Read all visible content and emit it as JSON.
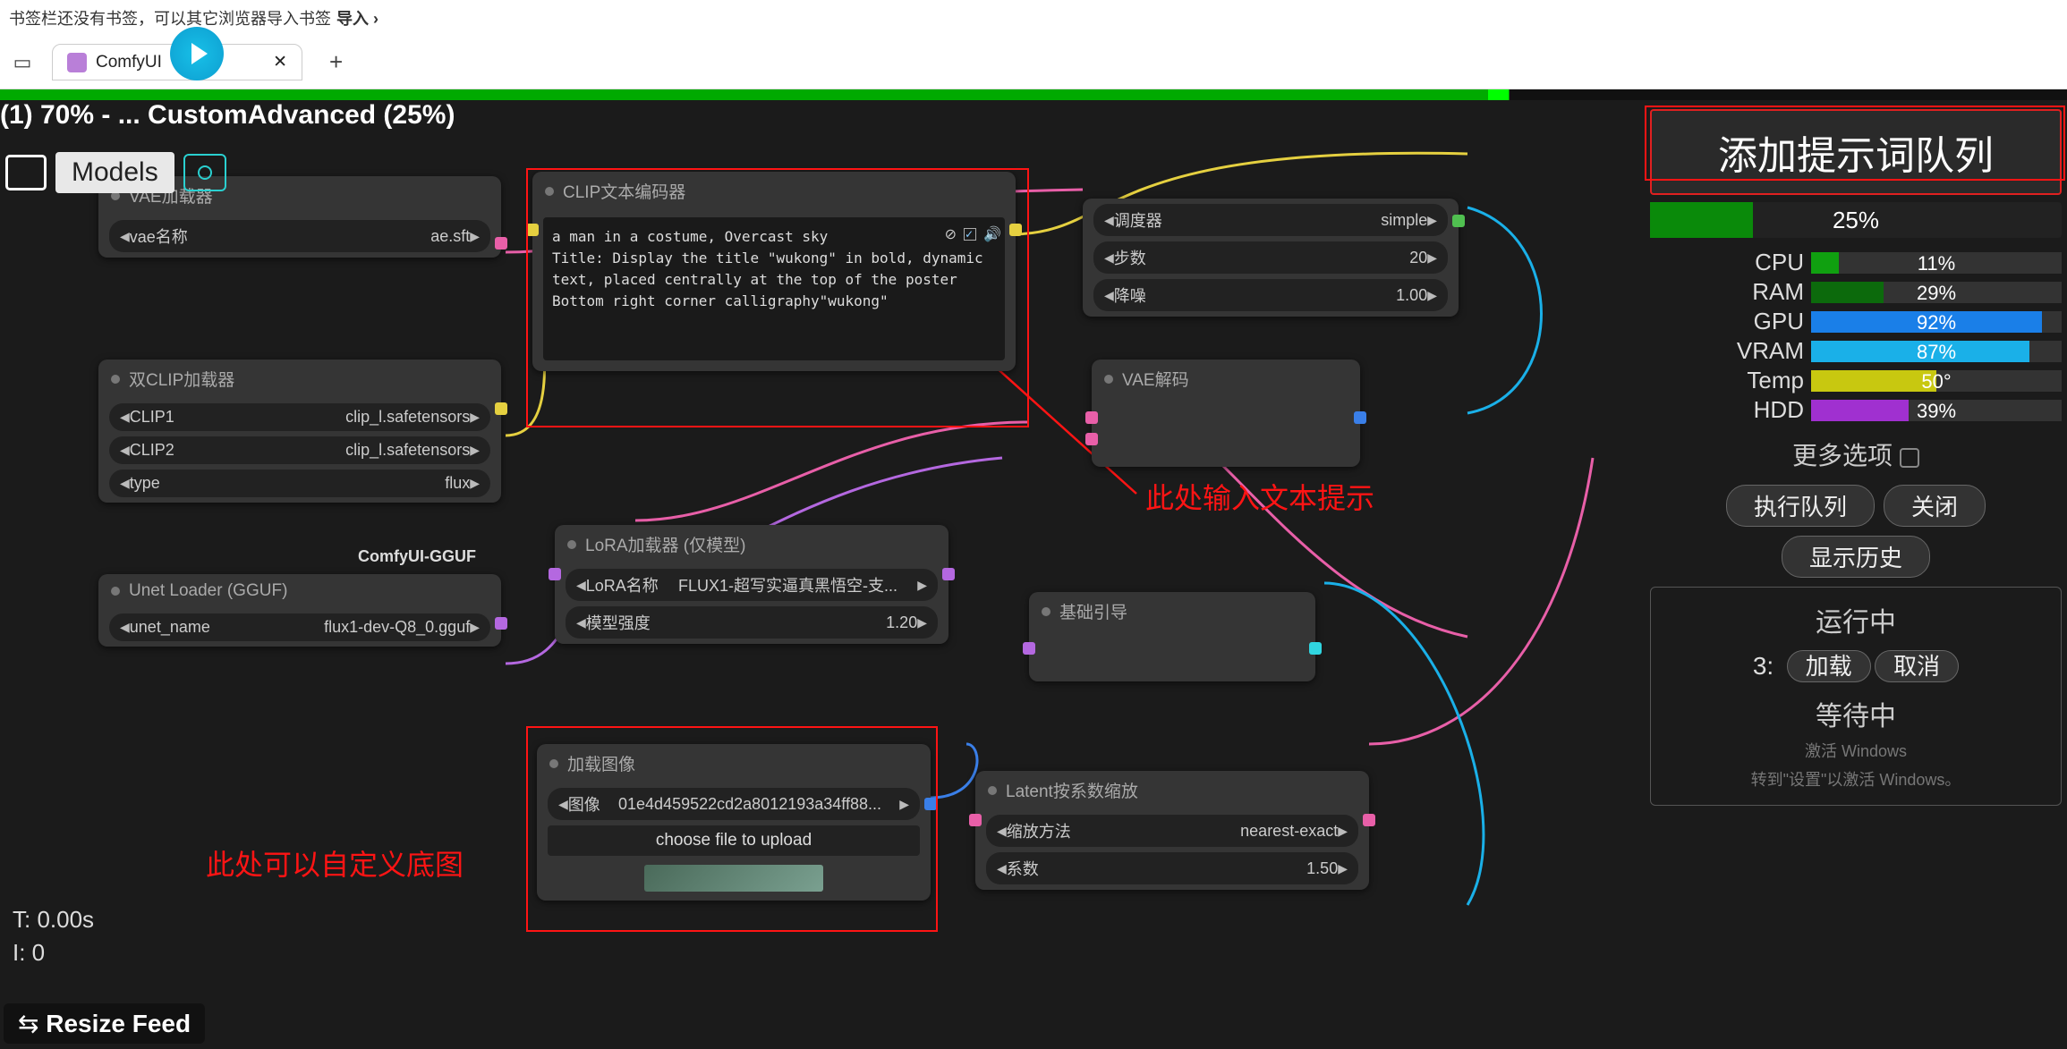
{
  "browser": {
    "bookmark_hint": "书签栏还没有书签，可以其它浏览器导入书签",
    "import_label": "导入",
    "tab_title": "ComfyUI"
  },
  "topbar": {
    "progress_text": "(1) 70% - ... CustomAdvanced (25%)",
    "models_btn": "Models"
  },
  "nodes": {
    "vae_loader": {
      "title": "VAE加载器",
      "field_label": "vae名称",
      "field_value": "ae.sft"
    },
    "dual_clip": {
      "title": "双CLIP加载器",
      "clip1_label": "CLIP1",
      "clip1_value": "clip_l.safetensors",
      "clip2_label": "CLIP2",
      "clip2_value": "clip_l.safetensors",
      "type_label": "type",
      "type_value": "flux",
      "badge": "ComfyUI-GGUF"
    },
    "unet_loader": {
      "title": "Unet Loader (GGUF)",
      "field_label": "unet_name",
      "field_value": "flux1-dev-Q8_0.gguf"
    },
    "clip_text": {
      "title": "CLIP文本编码器",
      "text": "a man in a costume, Overcast sky\nTitle: Display the title \"wukong\" in bold, dynamic text, placed centrally at the top of the poster\nBottom right corner calligraphy\"wukong\""
    },
    "lora": {
      "title": "LoRA加载器 (仅模型)",
      "name_label": "LoRA名称",
      "name_value": "FLUX1-超写实逼真黑悟空-支...",
      "strength_label": "模型强度",
      "strength_value": "1.20"
    },
    "load_image": {
      "title": "加载图像",
      "img_label": "图像",
      "img_value": "01e4d459522cd2a8012193a34ff88...",
      "upload_btn": "choose file to upload"
    },
    "latent_scale": {
      "title": "Latent按系数缩放",
      "method_label": "缩放方法",
      "method_value": "nearest-exact",
      "factor_label": "系数",
      "factor_value": "1.50"
    },
    "sampler_opts": {
      "sched_label": "调度器",
      "sched_value": "simple",
      "steps_label": "步数",
      "steps_value": "20",
      "denoise_label": "降噪",
      "denoise_value": "1.00"
    },
    "vae_decode": {
      "title": "VAE解码"
    },
    "basic_guide": {
      "title": "基础引导"
    }
  },
  "right_panel": {
    "queue_btn": "添加提示词队列",
    "progress_pct": "25%",
    "progress_fill": 25,
    "stats": {
      "cpu": {
        "label": "CPU",
        "value": "11%",
        "pct": 11,
        "color": "#10a010"
      },
      "ram": {
        "label": "RAM",
        "value": "29%",
        "pct": 29,
        "color": "#0c6a0c"
      },
      "gpu": {
        "label": "GPU",
        "value": "92%",
        "pct": 92,
        "color": "#1a7fe8"
      },
      "vram": {
        "label": "VRAM",
        "value": "87%",
        "pct": 87,
        "color": "#1ab0e8"
      },
      "temp": {
        "label": "Temp",
        "value": "50°",
        "pct": 50,
        "color": "#c8c810"
      },
      "hdd": {
        "label": "HDD",
        "value": "39%",
        "pct": 39,
        "color": "#a030d0"
      }
    },
    "more_options": "更多选项",
    "exec_queue": "执行队列",
    "close": "关闭",
    "show_history": "显示历史",
    "running": "运行中",
    "running_num": "3:",
    "load": "加载",
    "cancel": "取消",
    "waiting": "等待中",
    "watermark1": "激活 Windows",
    "watermark2": "转到\"设置\"以激活 Windows。"
  },
  "annotations": {
    "text_hint": "此处输入文本提示",
    "image_hint": "此处可以自定义底图"
  },
  "bottom_left": {
    "time": "T: 0.00s",
    "iter": "I: 0",
    "resize": "Resize Feed"
  }
}
